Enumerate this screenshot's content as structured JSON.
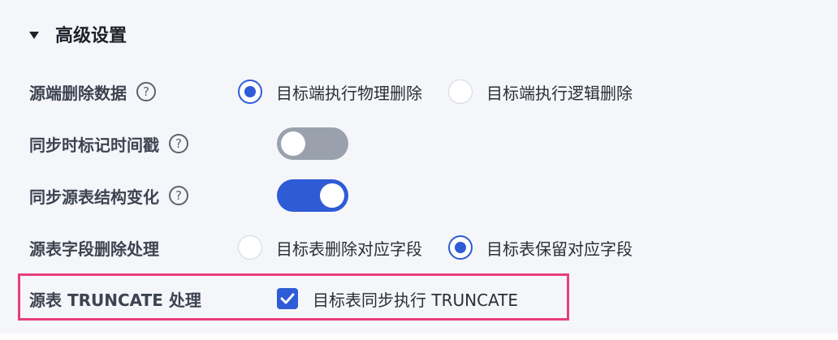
{
  "section": {
    "title": "高级设置"
  },
  "rows": {
    "source_delete": {
      "label": "源端删除数据",
      "help": "?",
      "options": [
        "目标端执行物理删除",
        "目标端执行逻辑删除"
      ],
      "selected": "目标端执行物理删除"
    },
    "sync_timestamp": {
      "label": "同步时标记时间戳",
      "help": "?",
      "enabled": false
    },
    "sync_schema": {
      "label": "同步源表结构变化",
      "help": "?",
      "enabled": true
    },
    "field_delete": {
      "label": "源表字段删除处理",
      "options": [
        "目标表删除对应字段",
        "目标表保留对应字段"
      ],
      "selected": "目标表保留对应字段"
    },
    "truncate": {
      "label": "源表 TRUNCATE 处理",
      "checkbox_label": "目标表同步执行 TRUNCATE",
      "checked": true
    }
  },
  "colors": {
    "accent": "#2f5bd6",
    "highlight": "#e83e7c",
    "switch_off": "#9aa1ad",
    "panel_bg": "#f4f6fa"
  }
}
